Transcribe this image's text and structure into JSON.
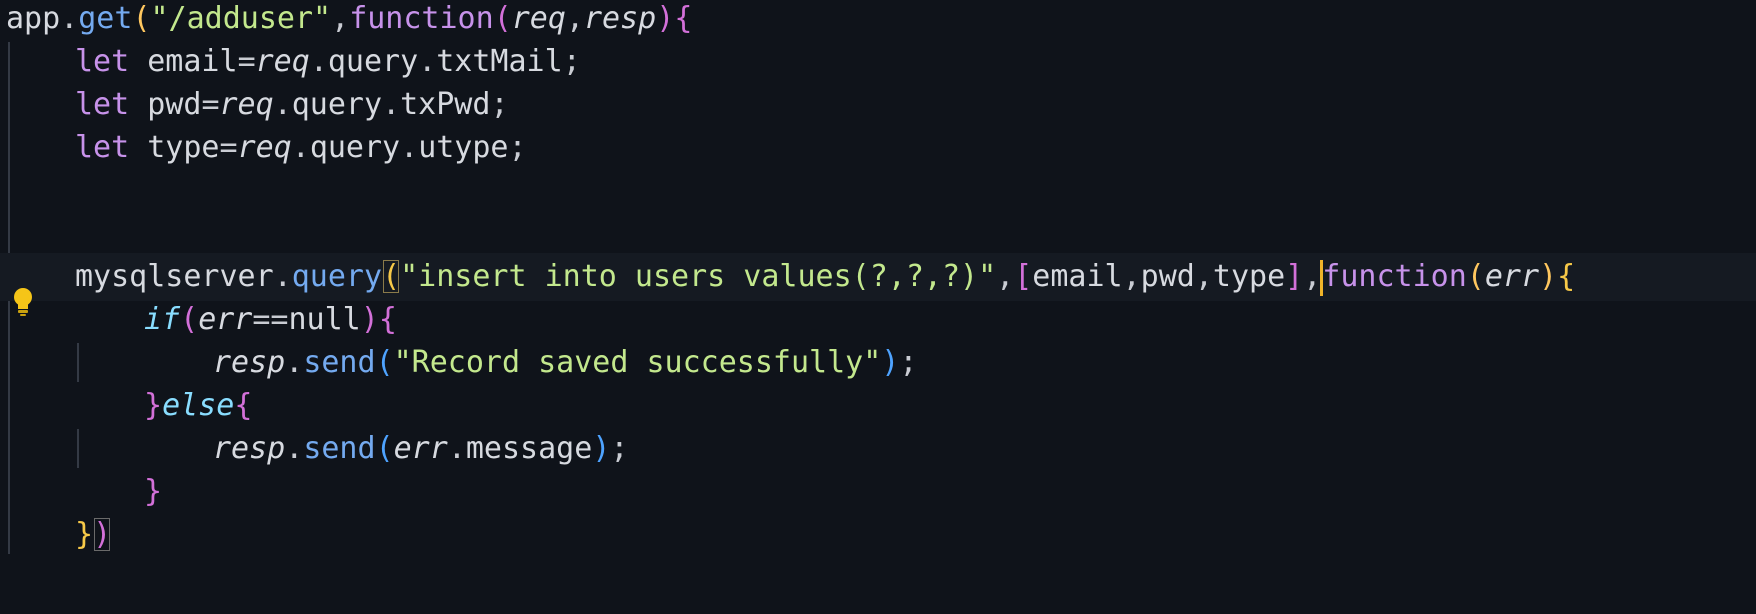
{
  "editor": {
    "lines": [
      {
        "indent": 0,
        "tokens": [
          {
            "t": "app",
            "c": "id"
          },
          {
            "t": ".",
            "c": "punc"
          },
          {
            "t": "get",
            "c": "fn"
          },
          {
            "t": "(",
            "c": "par"
          },
          {
            "t": "\"/adduser\"",
            "c": "str"
          },
          {
            "t": ",",
            "c": "punc"
          },
          {
            "t": "function",
            "c": "kw"
          },
          {
            "t": "(",
            "c": "p"
          },
          {
            "t": "req",
            "c": "it"
          },
          {
            "t": ",",
            "c": "punc"
          },
          {
            "t": "resp",
            "c": "it"
          },
          {
            "t": ")",
            "c": "p"
          },
          {
            "t": "{",
            "c": "p"
          }
        ]
      },
      {
        "indent": 1,
        "tokens": [
          {
            "t": "let ",
            "c": "kw"
          },
          {
            "t": "email",
            "c": "id"
          },
          {
            "t": "=",
            "c": "punc"
          },
          {
            "t": "req",
            "c": "it"
          },
          {
            "t": ".",
            "c": "punc"
          },
          {
            "t": "query",
            "c": "prop"
          },
          {
            "t": ".",
            "c": "punc"
          },
          {
            "t": "txtMail",
            "c": "prop"
          },
          {
            "t": ";",
            "c": "punc"
          }
        ]
      },
      {
        "indent": 1,
        "tokens": [
          {
            "t": "let ",
            "c": "kw"
          },
          {
            "t": "pwd",
            "c": "id"
          },
          {
            "t": "=",
            "c": "punc"
          },
          {
            "t": "req",
            "c": "it"
          },
          {
            "t": ".",
            "c": "punc"
          },
          {
            "t": "query",
            "c": "prop"
          },
          {
            "t": ".",
            "c": "punc"
          },
          {
            "t": "txPwd",
            "c": "prop"
          },
          {
            "t": ";",
            "c": "punc"
          }
        ]
      },
      {
        "indent": 1,
        "tokens": [
          {
            "t": "let ",
            "c": "kw"
          },
          {
            "t": "type",
            "c": "id"
          },
          {
            "t": "=",
            "c": "punc"
          },
          {
            "t": "req",
            "c": "it"
          },
          {
            "t": ".",
            "c": "punc"
          },
          {
            "t": "query",
            "c": "prop"
          },
          {
            "t": ".",
            "c": "punc"
          },
          {
            "t": "utype",
            "c": "prop"
          },
          {
            "t": ";",
            "c": "punc"
          }
        ]
      },
      {
        "indent": 1,
        "tokens": []
      },
      {
        "indent": 1,
        "tokens": []
      },
      {
        "indent": 1,
        "active": true,
        "tokens": [
          {
            "t": "mysqlserver",
            "c": "id"
          },
          {
            "t": ".",
            "c": "punc"
          },
          {
            "t": "query",
            "c": "fn"
          },
          {
            "t": "(",
            "c": "y",
            "box": 1
          },
          {
            "t": "\"insert into users values(?,?,?)\"",
            "c": "str"
          },
          {
            "t": ",",
            "c": "punc"
          },
          {
            "t": "[",
            "c": "p"
          },
          {
            "t": "email",
            "c": "id"
          },
          {
            "t": ",",
            "c": "punc"
          },
          {
            "t": "pwd",
            "c": "id"
          },
          {
            "t": ",",
            "c": "punc"
          },
          {
            "t": "type",
            "c": "id"
          },
          {
            "t": "]",
            "c": "p"
          },
          {
            "t": ",",
            "c": "punc"
          },
          {
            "caret": true
          },
          {
            "t": "function",
            "c": "kw"
          },
          {
            "t": "(",
            "c": "par"
          },
          {
            "t": "err",
            "c": "it"
          },
          {
            "t": ")",
            "c": "par"
          },
          {
            "t": "{",
            "c": "y"
          }
        ]
      },
      {
        "indent": 2,
        "tokens": [
          {
            "t": "if",
            "c": "ctl"
          },
          {
            "t": "(",
            "c": "p"
          },
          {
            "t": "err",
            "c": "it"
          },
          {
            "t": "==",
            "c": "punc"
          },
          {
            "t": "null",
            "c": "id"
          },
          {
            "t": ")",
            "c": "p"
          },
          {
            "t": "{",
            "c": "p"
          }
        ]
      },
      {
        "indent": 3,
        "tokens": [
          {
            "t": "resp",
            "c": "it"
          },
          {
            "t": ".",
            "c": "punc"
          },
          {
            "t": "send",
            "c": "fn"
          },
          {
            "t": "(",
            "c": "b"
          },
          {
            "t": "\"Record saved successfully\"",
            "c": "str"
          },
          {
            "t": ")",
            "c": "b"
          },
          {
            "t": ";",
            "c": "punc"
          }
        ]
      },
      {
        "indent": 2,
        "tokens": [
          {
            "t": "}",
            "c": "p"
          },
          {
            "t": "else",
            "c": "ctl"
          },
          {
            "t": "{",
            "c": "p"
          }
        ]
      },
      {
        "indent": 3,
        "tokens": [
          {
            "t": "resp",
            "c": "it"
          },
          {
            "t": ".",
            "c": "punc"
          },
          {
            "t": "send",
            "c": "fn"
          },
          {
            "t": "(",
            "c": "b"
          },
          {
            "t": "err",
            "c": "it"
          },
          {
            "t": ".",
            "c": "punc"
          },
          {
            "t": "message",
            "c": "prop"
          },
          {
            "t": ")",
            "c": "b"
          },
          {
            "t": ";",
            "c": "punc"
          }
        ]
      },
      {
        "indent": 2,
        "tokens": [
          {
            "t": "}",
            "c": "p"
          }
        ]
      },
      {
        "indent": 1,
        "tokens": [
          {
            "t": "}",
            "c": "y"
          },
          {
            "t": ")",
            "c": "p",
            "box": 2
          }
        ]
      }
    ]
  }
}
